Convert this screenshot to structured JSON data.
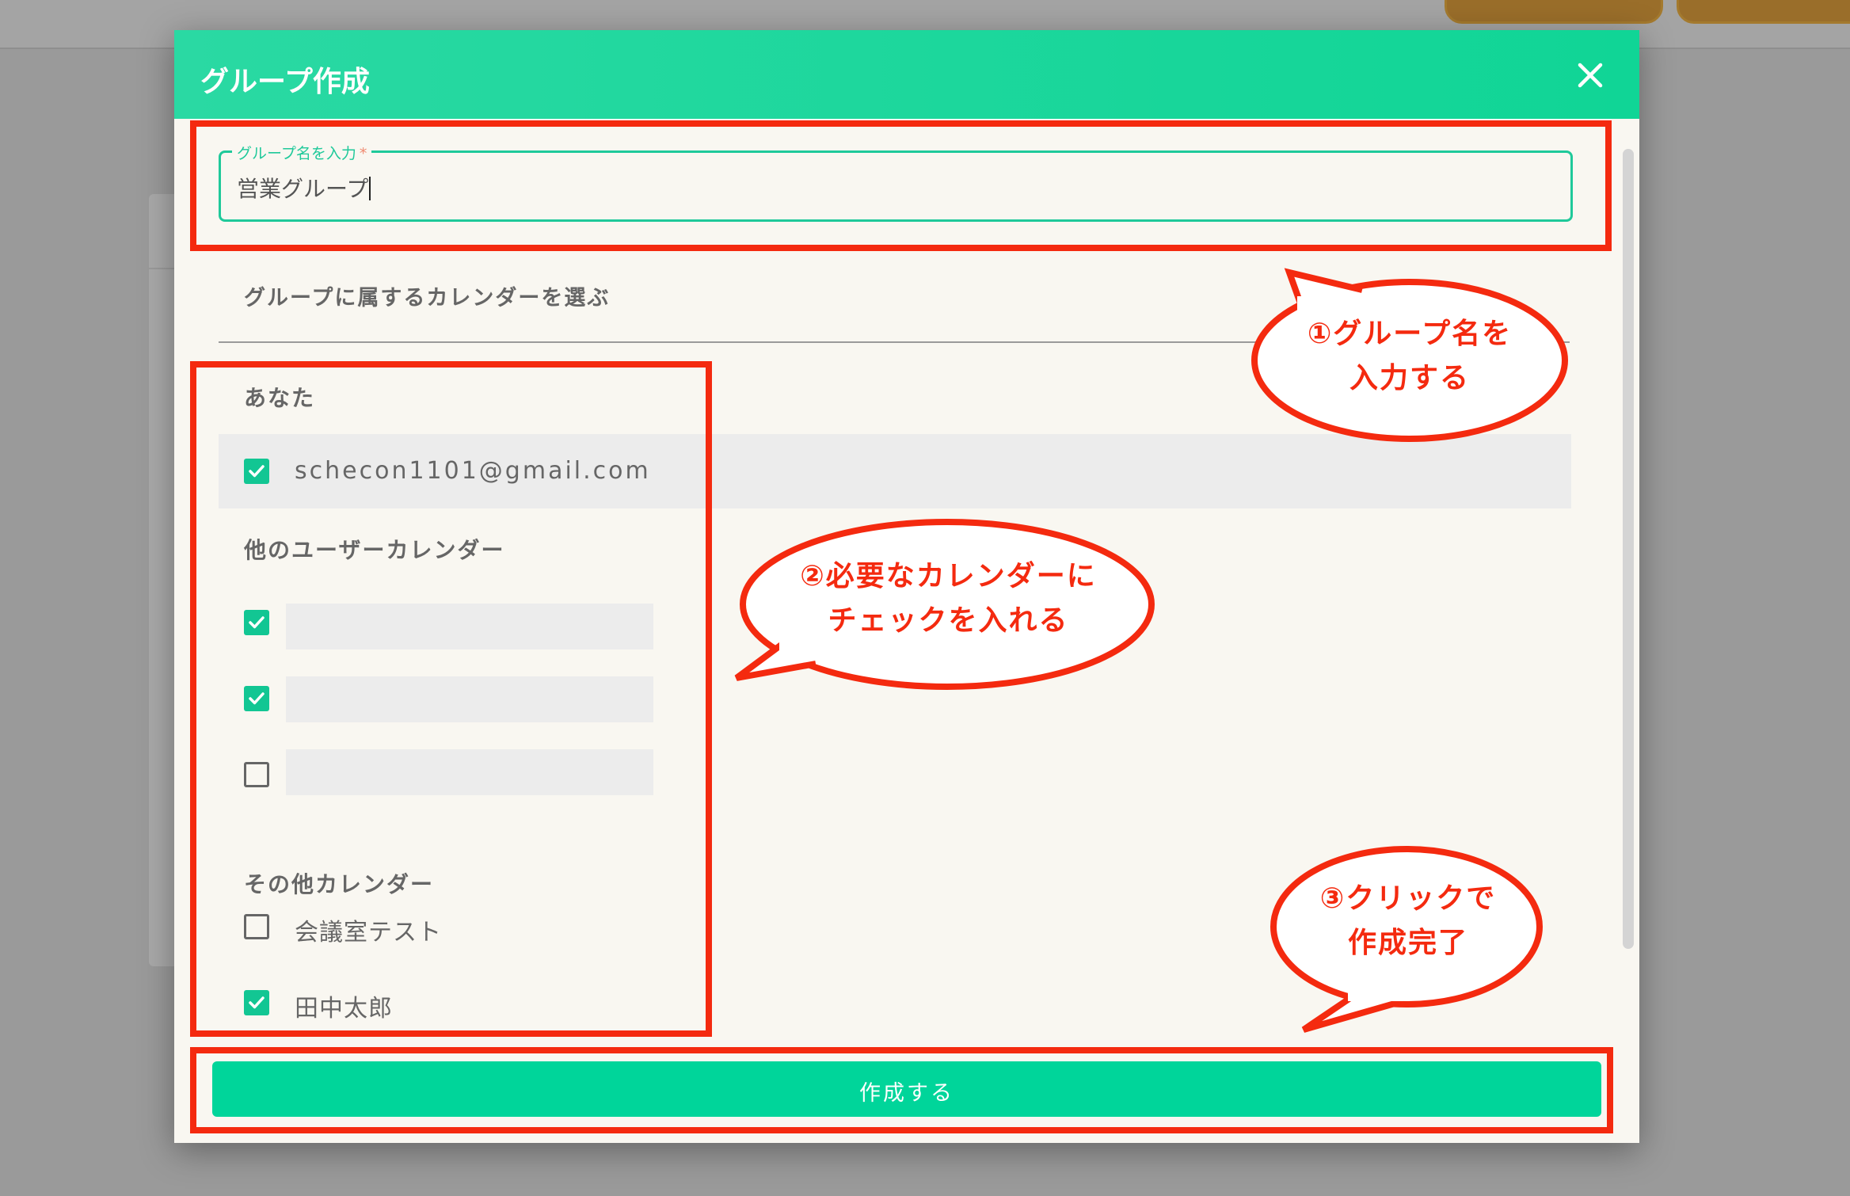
{
  "modal": {
    "title": "グループ作成",
    "name_field": {
      "label": "グループ名を入力",
      "required_mark": "*",
      "value": "営業グループ"
    },
    "calendar_section_title": "グループに属するカレンダーを選ぶ",
    "you_group": {
      "title": "あなた",
      "items": [
        {
          "label": "schecon1101@gmail.com",
          "checked": true
        }
      ]
    },
    "other_users_group": {
      "title": "他のユーザーカレンダー",
      "items": [
        {
          "checked": true
        },
        {
          "checked": true
        },
        {
          "checked": false
        }
      ]
    },
    "other_calendars_group": {
      "title": "その他カレンダー",
      "items": [
        {
          "label": "会議室テスト",
          "checked": false
        },
        {
          "label": "田中太郎",
          "checked": true
        }
      ]
    },
    "submit_label": "作成する"
  },
  "annotations": {
    "callout_1": {
      "line1": "①グループ名を",
      "line2": "入力する"
    },
    "callout_2": {
      "line1": "②必要なカレンダーに",
      "line2": "チェックを入れる"
    },
    "callout_3": {
      "line1": "③クリックで",
      "line2": "作成完了"
    }
  },
  "colors": {
    "accent": "#12c693",
    "header_gradient_start": "#2ad9a3",
    "header_gradient_end": "#10d596",
    "annotation_red": "#f42a0f",
    "modal_background": "#f9f7f1",
    "dim_background": "#9a9a9a"
  },
  "icons": {
    "close": "close-icon",
    "check": "check-icon"
  }
}
